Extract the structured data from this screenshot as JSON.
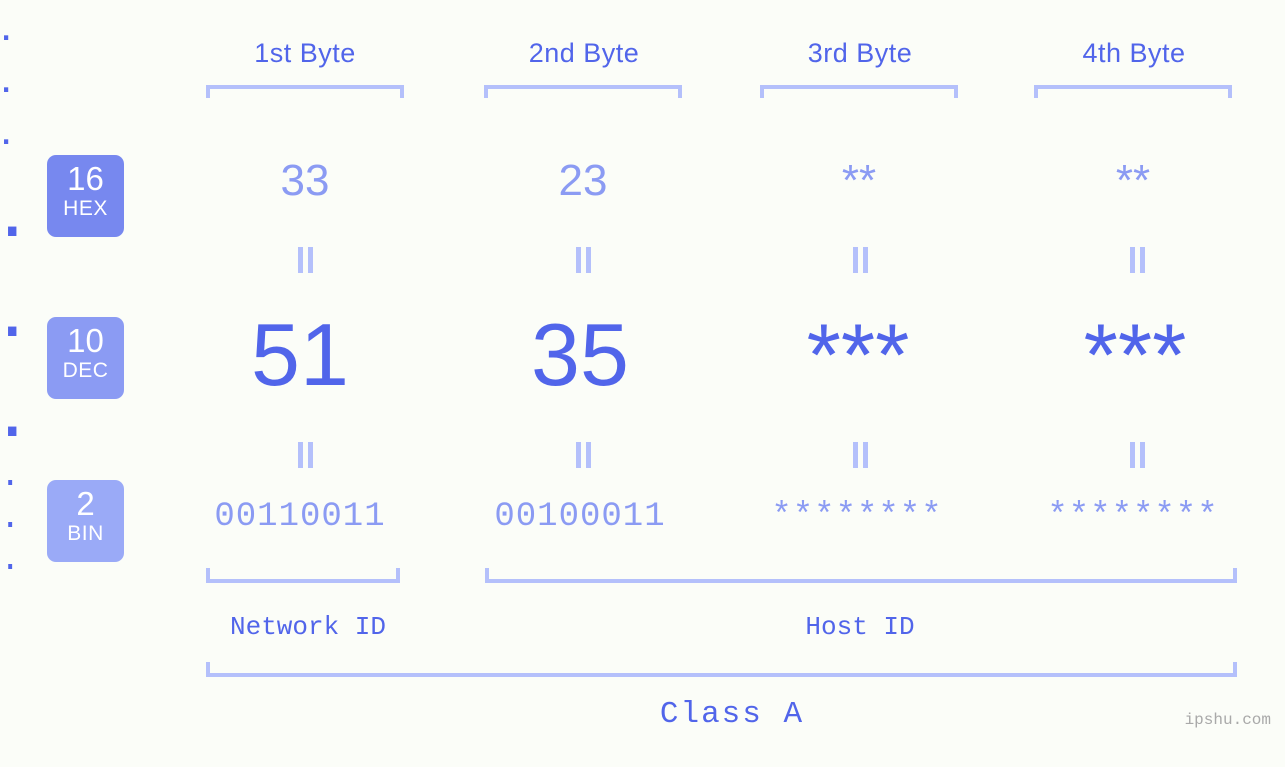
{
  "page": {
    "background": "#fbfdf8",
    "accent_dark": "#5165ea",
    "accent_mid": "#8b9bf3",
    "accent_light": "#b4c0fb",
    "watermark": "ipshu.com"
  },
  "byte_headers": [
    {
      "label": "1st Byte"
    },
    {
      "label": "2nd Byte"
    },
    {
      "label": "3rd Byte"
    },
    {
      "label": "4th Byte"
    }
  ],
  "bases": [
    {
      "number": "16",
      "name": "HEX",
      "color": "#7788ef"
    },
    {
      "number": "10",
      "name": "DEC",
      "color": "#8b9bf3"
    },
    {
      "number": "2",
      "name": "BIN",
      "color": "#9aaaf7"
    }
  ],
  "rows": {
    "hex": {
      "values": [
        "33",
        "23",
        "**",
        "**"
      ],
      "separator": "."
    },
    "dec": {
      "values": [
        "51",
        "35",
        "***",
        "***"
      ],
      "separator": "."
    },
    "bin": {
      "values": [
        "00110011",
        "00100011",
        "********",
        "********"
      ],
      "separator": "."
    }
  },
  "equals_glyph": "=",
  "segments": {
    "network_id": "Network ID",
    "host_id": "Host ID"
  },
  "class_label": "Class A"
}
